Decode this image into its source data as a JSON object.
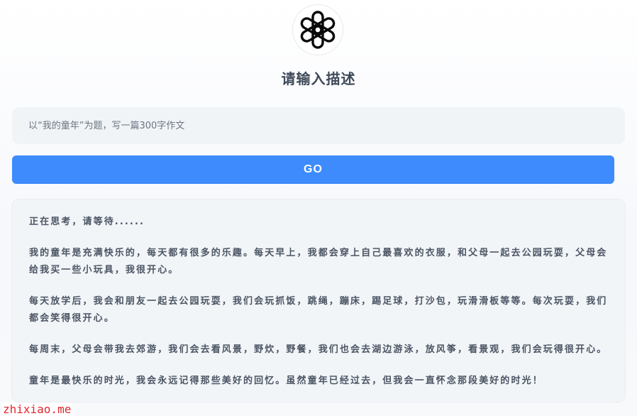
{
  "header": {
    "logo_icon": "openai-logo-icon",
    "title": "请输入描述"
  },
  "prompt": {
    "placeholder": "以“我的童年”为题，写一篇300字作文",
    "value": ""
  },
  "actions": {
    "go_label": "GO"
  },
  "result": {
    "status": "正在思考，请等待......",
    "paragraphs": [
      "我的童年是充满快乐的，每天都有很多的乐趣。每天早上，我都会穿上自己最喜欢的衣服，和父母一起去公园玩耍，父母会给我买一些小玩具，我很开心。",
      "每天放学后，我会和朋友一起去公园玩耍，我们会玩抓饭，跳绳，蹦床，踢足球，打沙包，玩滑滑板等等。每次玩耍，我们都会笑得很开心。",
      "每周末，父母会带我去郊游，我们会去看风景，野炊，野餐，我们也会去湖边游泳，放风筝，看景观，我们会玩得很开心。",
      "童年是最快乐的时光，我会永远记得那些美好的回忆。虽然童年已经过去，但我会一直怀念那段美好的时光！"
    ]
  },
  "watermark": "zhixiao.me",
  "colors": {
    "accent": "#3d8bfd",
    "watermark": "#e0262f"
  }
}
